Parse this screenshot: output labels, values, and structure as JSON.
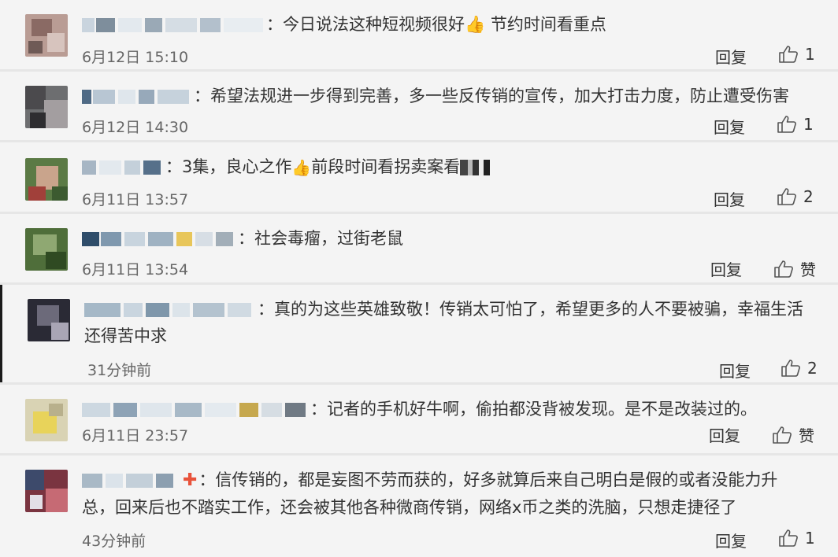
{
  "comments": [
    {
      "text": "：今日说法这种短视频很好👍 节约时间看重点",
      "time": "6月12日 15:10",
      "reply": "回复",
      "likes": "1"
    },
    {
      "text": "：希望法规进一步得到完善，多一些反传销的宣传，加大打击力度，防止遭受伤害",
      "time": "6月12日 14:30",
      "reply": "回复",
      "likes": "1"
    },
    {
      "text_a": "：3集，良心之作",
      "text_b": "前段时间看拐卖案看",
      "time": "6月11日 13:57",
      "reply": "回复",
      "likes": "2"
    },
    {
      "text": "：社会毒瘤，过街老鼠",
      "time": "6月11日 13:54",
      "reply": "回复",
      "likes": "赞"
    },
    {
      "text": "：真的为这些英雄致敬！传销太可怕了，希望更多的人不要被骗，幸福生活还得苦中求",
      "time": "31分钟前",
      "reply": "回复",
      "likes": "2"
    },
    {
      "text": "：记者的手机好牛啊，偷拍都没背被发现。是不是改装过的。",
      "time": "6月11日 23:57",
      "reply": "回复",
      "likes": "赞"
    },
    {
      "text": "：信传销的，都是妄图不劳而获的，好多就算后来自己明白是假的或者没能力升总，回来后也不踏实工作，还会被其他各种微商传销，网络x币之类的洗脑，只想走捷径了",
      "time": "43分钟前",
      "reply": "回复",
      "likes": "1"
    }
  ],
  "icons": {
    "like": "thumbs-up-outline-icon",
    "thumb_emoji": "thumbs-up-emoji",
    "red_cross": "red-cross-icon"
  },
  "colors": {
    "row_bg": "#f4f4f4",
    "separator": "#e6e6e6",
    "text": "#333333",
    "time": "#666666"
  }
}
